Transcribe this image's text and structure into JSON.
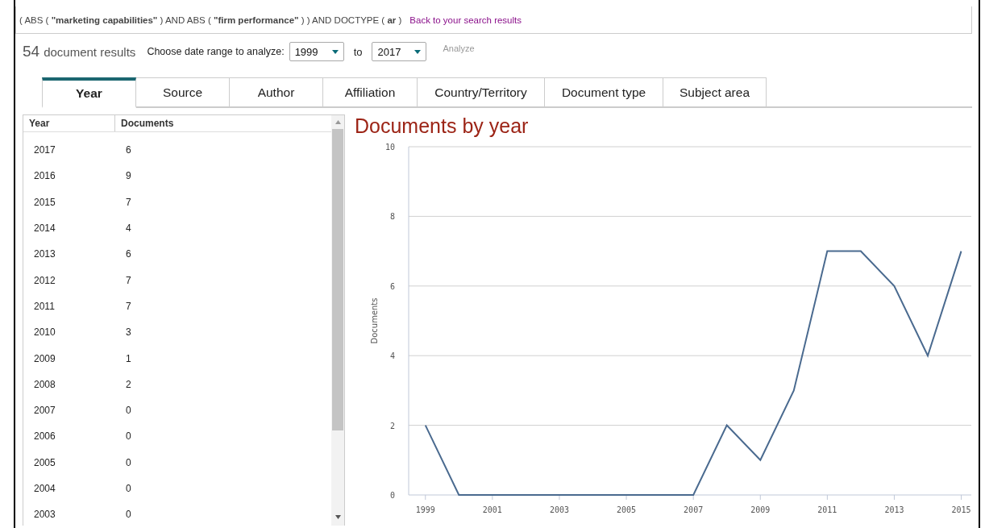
{
  "query": {
    "text": "( ABS ( **\"marketing capabilities\"** ) AND ABS ( **\"firm performance\"** ) ) AND DOCTYPE ( **ar** )",
    "link": "Back to your search results"
  },
  "results": {
    "count": "54",
    "label": "document results",
    "range_label": "Choose date range to analyze:",
    "from": "1999",
    "to_label": "to",
    "to": "2017",
    "analyze": "Analyze"
  },
  "tabs": [
    {
      "label": "Year",
      "selected": true
    },
    {
      "label": "Source",
      "selected": false
    },
    {
      "label": "Author",
      "selected": false
    },
    {
      "label": "Affiliation",
      "selected": false
    },
    {
      "label": "Country/Territory",
      "selected": false
    },
    {
      "label": "Document type",
      "selected": false
    },
    {
      "label": "Subject area",
      "selected": false
    }
  ],
  "table": {
    "columns": [
      "Year",
      "Documents"
    ],
    "rows": [
      [
        "2017",
        "6"
      ],
      [
        "2016",
        "9"
      ],
      [
        "2015",
        "7"
      ],
      [
        "2014",
        "4"
      ],
      [
        "2013",
        "6"
      ],
      [
        "2012",
        "7"
      ],
      [
        "2011",
        "7"
      ],
      [
        "2010",
        "3"
      ],
      [
        "2009",
        "1"
      ],
      [
        "2008",
        "2"
      ],
      [
        "2007",
        "0"
      ],
      [
        "2006",
        "0"
      ],
      [
        "2005",
        "0"
      ],
      [
        "2004",
        "0"
      ],
      [
        "2003",
        "0"
      ]
    ]
  },
  "chart": {
    "title": "Documents by year",
    "chart_data": {
      "type": "line",
      "ylabel": "Documents",
      "x": [
        1999,
        2000,
        2001,
        2002,
        2003,
        2004,
        2005,
        2006,
        2007,
        2008,
        2009,
        2010,
        2011,
        2012,
        2013,
        2014,
        2015
      ],
      "values": [
        2,
        0,
        0,
        0,
        0,
        0,
        0,
        0,
        0,
        2,
        1,
        3,
        7,
        7,
        6,
        4,
        7
      ],
      "grid": true,
      "xlim": [
        1998.5,
        2015.3
      ],
      "ylim": [
        0,
        10
      ],
      "xticks": [
        1999,
        2001,
        2003,
        2005,
        2007,
        2009,
        2011,
        2013,
        2015
      ],
      "yticks": [
        0,
        2,
        4,
        6,
        8,
        10
      ]
    }
  }
}
